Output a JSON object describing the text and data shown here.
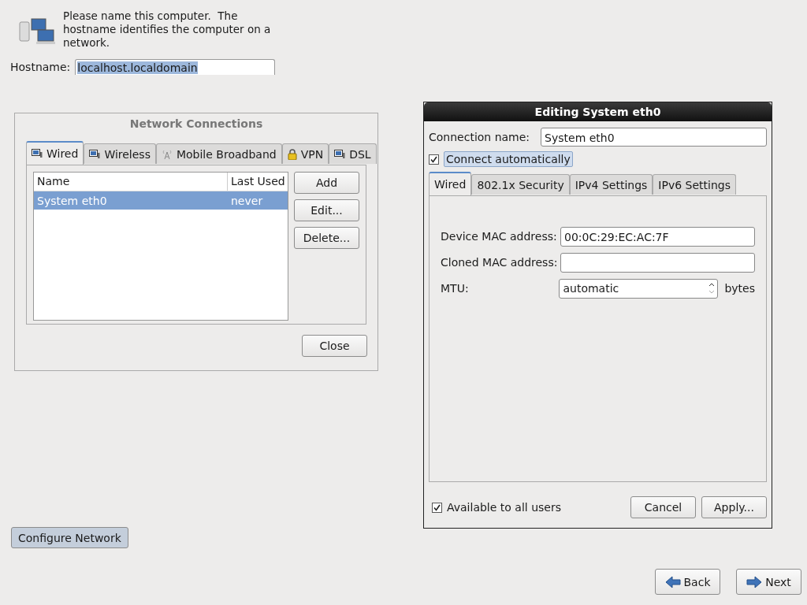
{
  "intro": {
    "text": "Please name this computer.  The hostname identifies the computer on a network."
  },
  "hostname": {
    "label": "Hostname:",
    "value": "localhost.localdomain"
  },
  "network_connections": {
    "title": "Network Connections",
    "tabs": [
      {
        "label": "Wired",
        "kind": "network",
        "selected": true
      },
      {
        "label": "Wireless",
        "kind": "network",
        "selected": false
      },
      {
        "label": "Mobile Broadband",
        "kind": "antenna",
        "selected": false
      },
      {
        "label": "VPN",
        "kind": "lock",
        "selected": false
      },
      {
        "label": "DSL",
        "kind": "network",
        "selected": false
      }
    ],
    "columns": [
      "Name",
      "Last Used"
    ],
    "rows": [
      {
        "name": "System eth0",
        "last_used": "never",
        "selected": true
      }
    ],
    "buttons": [
      "Add",
      "Edit...",
      "Delete..."
    ],
    "close": "Close"
  },
  "editor": {
    "title": "Editing System eth0",
    "connection_name": {
      "label": "Connection name:",
      "value": "System eth0"
    },
    "connect_automatically": {
      "label": "Connect automatically",
      "checked": true
    },
    "tabs": [
      {
        "label": "Wired",
        "selected": true
      },
      {
        "label": "802.1x Security",
        "selected": false
      },
      {
        "label": "IPv4 Settings",
        "selected": false
      },
      {
        "label": "IPv6 Settings",
        "selected": false
      }
    ],
    "fields": [
      {
        "label": "Device MAC address:",
        "kind": "text",
        "value": "00:0C:29:EC:AC:7F"
      },
      {
        "label": "Cloned MAC address:",
        "kind": "text"
      },
      {
        "label": "MTU:",
        "kind": "spin",
        "value": "automatic",
        "unit": "bytes"
      }
    ],
    "available_to_all": {
      "label": "Available to all users",
      "checked": true
    },
    "buttons": [
      "Cancel",
      "Apply..."
    ]
  },
  "configure_network": "Configure Network",
  "nav": [
    {
      "label": "Back",
      "kind": "back"
    },
    {
      "label": "Next",
      "kind": "next"
    }
  ]
}
